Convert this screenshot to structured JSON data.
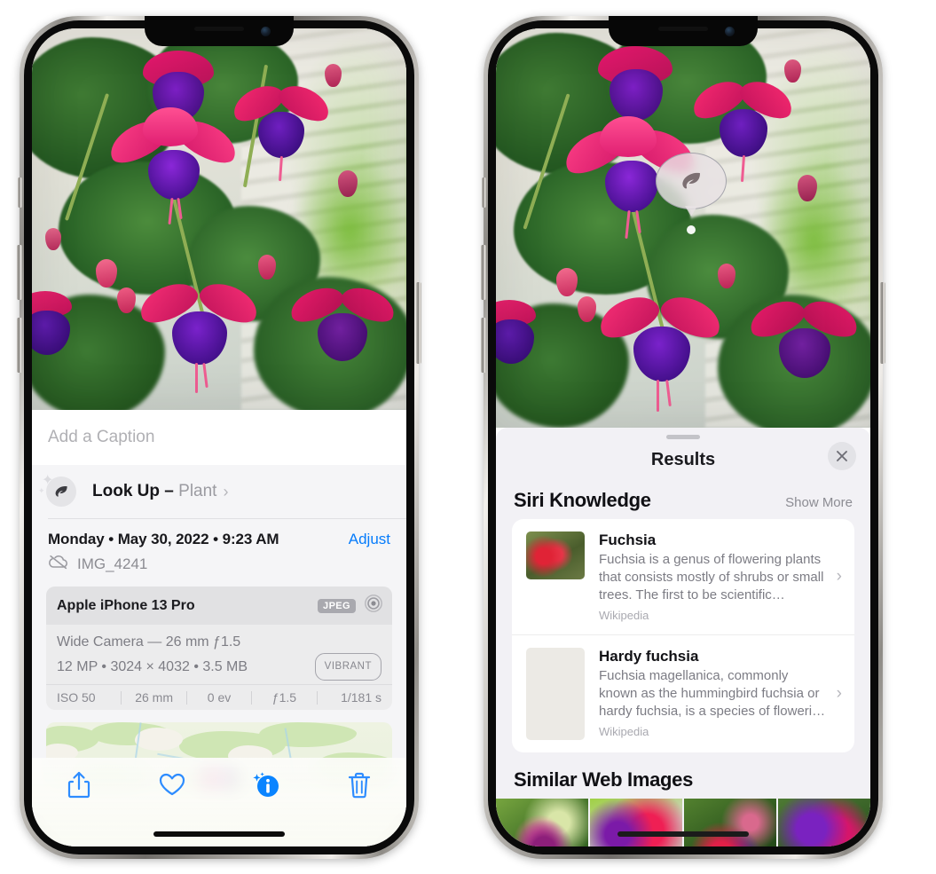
{
  "left_phone": {
    "caption_field": {
      "placeholder": "Add a Caption",
      "value": ""
    },
    "look_up": {
      "label": "Look Up",
      "dash": "–",
      "subject": "Plant",
      "chevron": "›",
      "icon": "leaf-icon",
      "sparkle": "✦"
    },
    "date_row": {
      "date": "Monday • May 30, 2022 • 9:23 AM",
      "adjust": "Adjust"
    },
    "file_row": {
      "filename": "IMG_4241",
      "icon": "icloud-slash-icon"
    },
    "metadata_card": {
      "device": "Apple iPhone 13 Pro",
      "format_badge": "JPEG",
      "aperture_icon": "lens-icon",
      "lens_line": "Wide Camera — 26 mm ƒ1.5",
      "specs_line": "12 MP • 3024 × 4032 • 3.5 MB",
      "style_badge": "VIBRANT",
      "exif": [
        "ISO 50",
        "26 mm",
        "0 ev",
        "ƒ1.5",
        "1/181 s"
      ]
    },
    "map": {
      "pin": "photo-thumbnail-pin"
    },
    "toolbar": [
      {
        "name": "share-button",
        "icon": "share-icon"
      },
      {
        "name": "favorite-button",
        "icon": "heart-icon"
      },
      {
        "name": "info-button",
        "icon": "info-sparkle-icon",
        "active": true
      },
      {
        "name": "delete-button",
        "icon": "trash-icon"
      }
    ],
    "accent_color": "#067cfb"
  },
  "right_phone": {
    "visual_look_up_badge": {
      "icon": "leaf-icon"
    },
    "sheet": {
      "grabber": true,
      "title": "Results",
      "close_icon": "close-icon"
    },
    "siri_knowledge": {
      "heading": "Siri Knowledge",
      "show_more": "Show More",
      "items": [
        {
          "title": "Fuchsia",
          "description": "Fuchsia is a genus of flowering plants that consists mostly of shrubs or small trees. The first to be scientific…",
          "source": "Wikipedia",
          "chevron": "›",
          "thumb": "fuchsia-red-flowers-thumbnail"
        },
        {
          "title": "Hardy fuchsia",
          "description": "Fuchsia magellanica, commonly known as the hummingbird fuchsia or hardy fuchsia, is a species of floweri…",
          "source": "Wikipedia",
          "chevron": "›",
          "thumb": "hardy-fuchsia-branch-thumbnail"
        }
      ]
    },
    "similar_web_images": {
      "heading": "Similar Web Images",
      "thumbs": [
        "fuchsia-pink-white-bloom",
        "fuchsia-red-closeup",
        "fuchsia-bush-buds",
        "fuchsia-purple-magenta"
      ]
    }
  },
  "colors": {
    "ios_blue": "#067cfb",
    "sheet_bg": "#f2f1f5",
    "card_bg": "#ffffff",
    "muted_text": "#8c8c93"
  }
}
